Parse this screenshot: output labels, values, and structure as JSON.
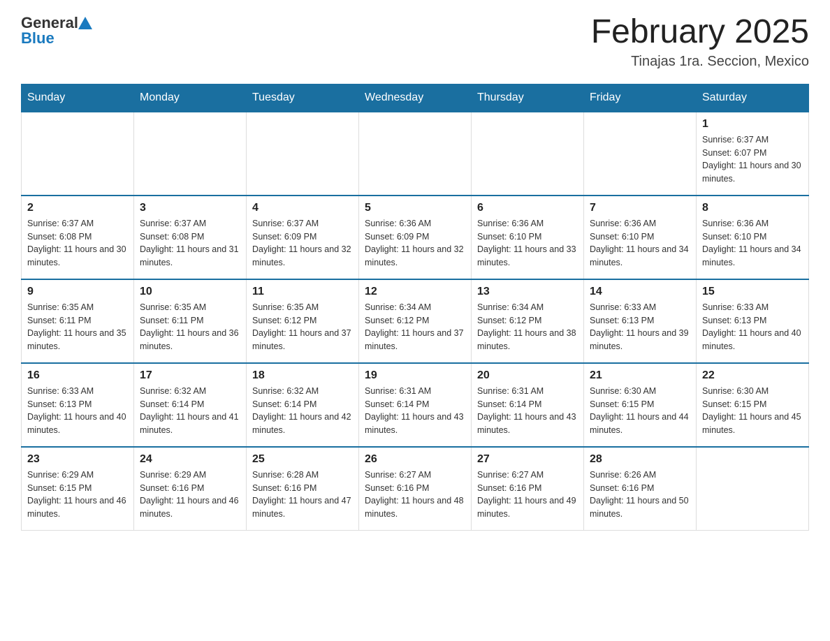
{
  "logo": {
    "general": "General",
    "blue": "Blue"
  },
  "title": "February 2025",
  "subtitle": "Tinajas 1ra. Seccion, Mexico",
  "days_of_week": [
    "Sunday",
    "Monday",
    "Tuesday",
    "Wednesday",
    "Thursday",
    "Friday",
    "Saturday"
  ],
  "weeks": [
    [
      {
        "day": "",
        "sunrise": "",
        "sunset": "",
        "daylight": ""
      },
      {
        "day": "",
        "sunrise": "",
        "sunset": "",
        "daylight": ""
      },
      {
        "day": "",
        "sunrise": "",
        "sunset": "",
        "daylight": ""
      },
      {
        "day": "",
        "sunrise": "",
        "sunset": "",
        "daylight": ""
      },
      {
        "day": "",
        "sunrise": "",
        "sunset": "",
        "daylight": ""
      },
      {
        "day": "",
        "sunrise": "",
        "sunset": "",
        "daylight": ""
      },
      {
        "day": "1",
        "sunrise": "Sunrise: 6:37 AM",
        "sunset": "Sunset: 6:07 PM",
        "daylight": "Daylight: 11 hours and 30 minutes."
      }
    ],
    [
      {
        "day": "2",
        "sunrise": "Sunrise: 6:37 AM",
        "sunset": "Sunset: 6:08 PM",
        "daylight": "Daylight: 11 hours and 30 minutes."
      },
      {
        "day": "3",
        "sunrise": "Sunrise: 6:37 AM",
        "sunset": "Sunset: 6:08 PM",
        "daylight": "Daylight: 11 hours and 31 minutes."
      },
      {
        "day": "4",
        "sunrise": "Sunrise: 6:37 AM",
        "sunset": "Sunset: 6:09 PM",
        "daylight": "Daylight: 11 hours and 32 minutes."
      },
      {
        "day": "5",
        "sunrise": "Sunrise: 6:36 AM",
        "sunset": "Sunset: 6:09 PM",
        "daylight": "Daylight: 11 hours and 32 minutes."
      },
      {
        "day": "6",
        "sunrise": "Sunrise: 6:36 AM",
        "sunset": "Sunset: 6:10 PM",
        "daylight": "Daylight: 11 hours and 33 minutes."
      },
      {
        "day": "7",
        "sunrise": "Sunrise: 6:36 AM",
        "sunset": "Sunset: 6:10 PM",
        "daylight": "Daylight: 11 hours and 34 minutes."
      },
      {
        "day": "8",
        "sunrise": "Sunrise: 6:36 AM",
        "sunset": "Sunset: 6:10 PM",
        "daylight": "Daylight: 11 hours and 34 minutes."
      }
    ],
    [
      {
        "day": "9",
        "sunrise": "Sunrise: 6:35 AM",
        "sunset": "Sunset: 6:11 PM",
        "daylight": "Daylight: 11 hours and 35 minutes."
      },
      {
        "day": "10",
        "sunrise": "Sunrise: 6:35 AM",
        "sunset": "Sunset: 6:11 PM",
        "daylight": "Daylight: 11 hours and 36 minutes."
      },
      {
        "day": "11",
        "sunrise": "Sunrise: 6:35 AM",
        "sunset": "Sunset: 6:12 PM",
        "daylight": "Daylight: 11 hours and 37 minutes."
      },
      {
        "day": "12",
        "sunrise": "Sunrise: 6:34 AM",
        "sunset": "Sunset: 6:12 PM",
        "daylight": "Daylight: 11 hours and 37 minutes."
      },
      {
        "day": "13",
        "sunrise": "Sunrise: 6:34 AM",
        "sunset": "Sunset: 6:12 PM",
        "daylight": "Daylight: 11 hours and 38 minutes."
      },
      {
        "day": "14",
        "sunrise": "Sunrise: 6:33 AM",
        "sunset": "Sunset: 6:13 PM",
        "daylight": "Daylight: 11 hours and 39 minutes."
      },
      {
        "day": "15",
        "sunrise": "Sunrise: 6:33 AM",
        "sunset": "Sunset: 6:13 PM",
        "daylight": "Daylight: 11 hours and 40 minutes."
      }
    ],
    [
      {
        "day": "16",
        "sunrise": "Sunrise: 6:33 AM",
        "sunset": "Sunset: 6:13 PM",
        "daylight": "Daylight: 11 hours and 40 minutes."
      },
      {
        "day": "17",
        "sunrise": "Sunrise: 6:32 AM",
        "sunset": "Sunset: 6:14 PM",
        "daylight": "Daylight: 11 hours and 41 minutes."
      },
      {
        "day": "18",
        "sunrise": "Sunrise: 6:32 AM",
        "sunset": "Sunset: 6:14 PM",
        "daylight": "Daylight: 11 hours and 42 minutes."
      },
      {
        "day": "19",
        "sunrise": "Sunrise: 6:31 AM",
        "sunset": "Sunset: 6:14 PM",
        "daylight": "Daylight: 11 hours and 43 minutes."
      },
      {
        "day": "20",
        "sunrise": "Sunrise: 6:31 AM",
        "sunset": "Sunset: 6:14 PM",
        "daylight": "Daylight: 11 hours and 43 minutes."
      },
      {
        "day": "21",
        "sunrise": "Sunrise: 6:30 AM",
        "sunset": "Sunset: 6:15 PM",
        "daylight": "Daylight: 11 hours and 44 minutes."
      },
      {
        "day": "22",
        "sunrise": "Sunrise: 6:30 AM",
        "sunset": "Sunset: 6:15 PM",
        "daylight": "Daylight: 11 hours and 45 minutes."
      }
    ],
    [
      {
        "day": "23",
        "sunrise": "Sunrise: 6:29 AM",
        "sunset": "Sunset: 6:15 PM",
        "daylight": "Daylight: 11 hours and 46 minutes."
      },
      {
        "day": "24",
        "sunrise": "Sunrise: 6:29 AM",
        "sunset": "Sunset: 6:16 PM",
        "daylight": "Daylight: 11 hours and 46 minutes."
      },
      {
        "day": "25",
        "sunrise": "Sunrise: 6:28 AM",
        "sunset": "Sunset: 6:16 PM",
        "daylight": "Daylight: 11 hours and 47 minutes."
      },
      {
        "day": "26",
        "sunrise": "Sunrise: 6:27 AM",
        "sunset": "Sunset: 6:16 PM",
        "daylight": "Daylight: 11 hours and 48 minutes."
      },
      {
        "day": "27",
        "sunrise": "Sunrise: 6:27 AM",
        "sunset": "Sunset: 6:16 PM",
        "daylight": "Daylight: 11 hours and 49 minutes."
      },
      {
        "day": "28",
        "sunrise": "Sunrise: 6:26 AM",
        "sunset": "Sunset: 6:16 PM",
        "daylight": "Daylight: 11 hours and 50 minutes."
      },
      {
        "day": "",
        "sunrise": "",
        "sunset": "",
        "daylight": ""
      }
    ]
  ]
}
